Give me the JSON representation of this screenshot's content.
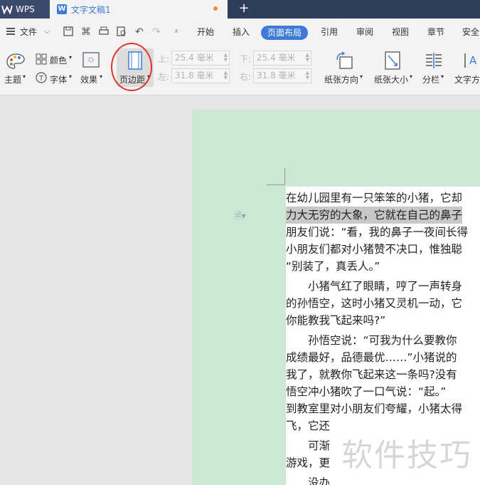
{
  "titlebar": {
    "app_name": "WPS",
    "doc_tab": "文字文稿1",
    "doc_icon_letter": "W",
    "new_tab_symbol": "+"
  },
  "menubar": {
    "file_label": "文件",
    "tabs": [
      "开始",
      "插入",
      "页面布局",
      "引用",
      "审阅",
      "视图",
      "章节",
      "安全"
    ],
    "active_tab": "页面布局"
  },
  "ribbon": {
    "theme_label": "主题",
    "color_label": "颜色",
    "font_label": "字体",
    "effect_label": "效果",
    "margin_label": "页边距",
    "top_label": "上:",
    "top_value": "25.4 毫米",
    "bottom_label": "下:",
    "bottom_value": "25.4 毫米",
    "left_label": "左:",
    "left_value": "31.8 毫米",
    "right_label": "右:",
    "right_value": "31.8 毫米",
    "orientation_label": "纸张方向",
    "size_label": "纸张大小",
    "columns_label": "分栏",
    "text_dir_label": "文字方"
  },
  "document": {
    "lines": [
      "在幼儿园里有一只笨笨的小猪，它却",
      "力大无穷的大象，它就在自己的鼻子",
      "朋友们说：“看，我的鼻子一夜间长得",
      "小朋友们都对小猪赞不决口，惟独聪",
      "“别装了，真丢人。”",
      "　　小猪气红了眼睛，哼了一声转身",
      "的孙悟空，这时小猪又灵机一动，它",
      "你能教我飞起来吗?”",
      "　　孙悟空说：“可我为什么要教你",
      "成绩最好，品德最优……”小猪说的",
      "我了，就教你飞起来这一条吗?没有",
      "悟空冲小猪吹了一口气说：“起。”",
      "到教室里对小朋友们夸耀，小猪太得",
      "飞，它还",
      "　　可渐",
      "游戏，更",
      "　　没办"
    ],
    "selected_line_index": 1,
    "watermark": "软件技巧"
  },
  "colors": {
    "titlebar_bg": "#2f3d5c",
    "accent": "#3d7bd8",
    "page_bg": "#cde8d2",
    "highlight_circle": "#e2322c"
  }
}
